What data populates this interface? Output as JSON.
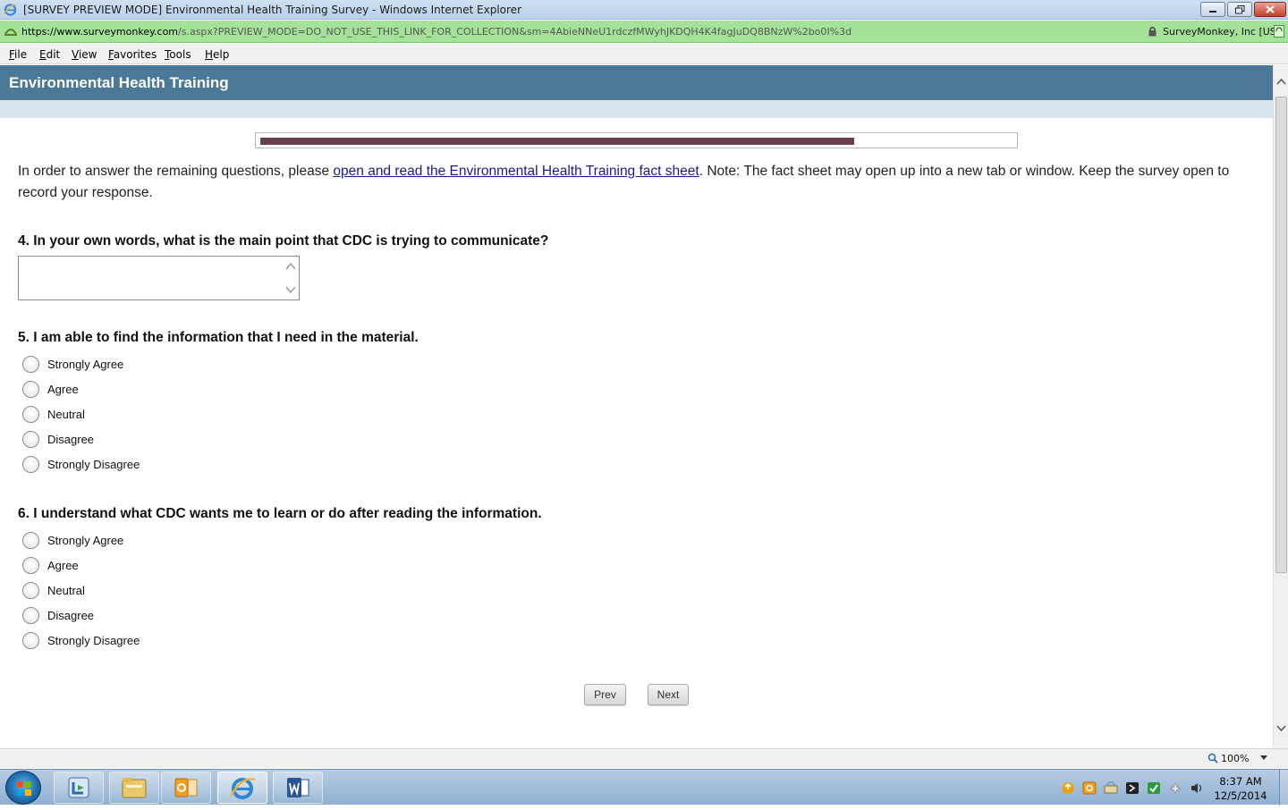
{
  "window": {
    "title": "[SURVEY PREVIEW MODE] Environmental Health Training Survey - Windows Internet Explorer"
  },
  "address_bar": {
    "url_host": "https://www.surveymonkey.com",
    "url_path": "/s.aspx?PREVIEW_MODE=DO_NOT_USE_THIS_LINK_FOR_COLLECTION&sm=4AbieNNeU1rdczfMWyhJKDQH4K4fagJuDQ8BNzW%2bo0I%3d",
    "certificate": "SurveyMonkey, Inc [US]"
  },
  "menu": [
    "File",
    "Edit",
    "View",
    "Favorites",
    "Tools",
    "Help"
  ],
  "survey": {
    "title": "Environmental Health Training",
    "progress_fraction": 0.79,
    "intro_before_link": "In order to answer the remaining questions, please ",
    "intro_link": "open and read the Environmental Health Training fact sheet",
    "intro_after_link": ". Note: The fact sheet may open up into a new tab or window. Keep the survey open to record your response.",
    "questions": [
      {
        "title": "4. In your own words, what is the main point that CDC is trying to communicate?",
        "answer": ""
      },
      {
        "title": "5. I am able to find the information that I need in the material.",
        "options": [
          "Strongly Agree",
          "Agree",
          "Neutral",
          "Disagree",
          "Strongly Disagree"
        ]
      },
      {
        "title": "6. I understand what CDC wants me to learn or do after reading the information.",
        "options": [
          "Strongly Agree",
          "Agree",
          "Neutral",
          "Disagree",
          "Strongly Disagree"
        ]
      }
    ],
    "prev_label": "Prev",
    "next_label": "Next"
  },
  "status_bar": {
    "zoom": "100%"
  },
  "taskbar": {
    "apps": [
      "lync-icon",
      "windows-explorer-icon",
      "outlook-icon",
      "internet-explorer-icon",
      "word-icon"
    ],
    "clock_time": "8:37 AM",
    "clock_date": "12/5/2014"
  },
  "colors": {
    "header_bg": "#4b7896",
    "progress_fill": "#6a3d4f",
    "address_bar_bg": "#a4e29a",
    "link": "#1a1a8c"
  }
}
